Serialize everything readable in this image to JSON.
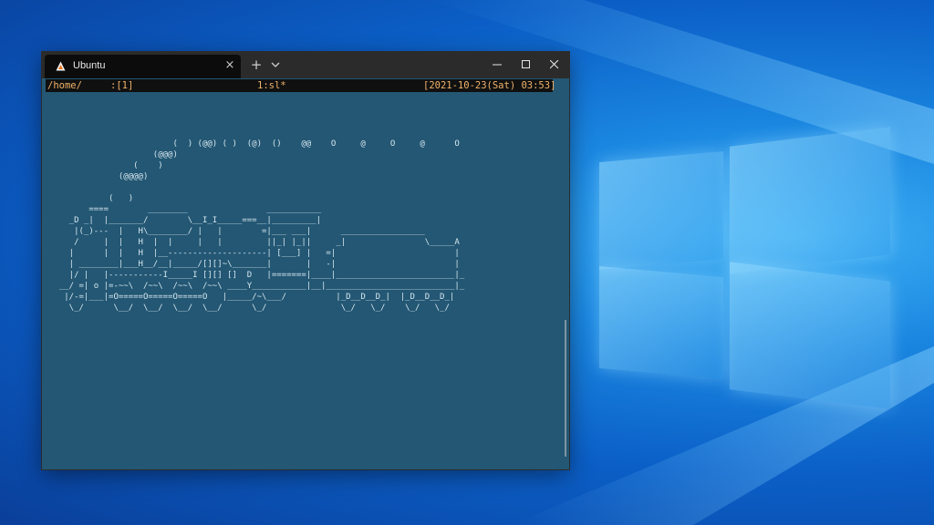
{
  "window": {
    "tab_title": "Ubuntu",
    "new_tab_symbol": "+",
    "close_tab_symbol": "×"
  },
  "statusbar": {
    "left": "/home/",
    "window_index": ":[1]",
    "window_name": "1:sl*",
    "datetime": "[2021-10-23(Sat) 03:53]"
  },
  "terminal": {
    "art_lines": [
      "                         (  ) (@@) ( )  (@)  ()    @@    O     @     O     @      O",
      "                     (@@@)",
      "                 (    )",
      "              (@@@@)",
      "",
      "            (   )",
      "        ====        ________                ___________",
      "    _D _|  |_______/        \\__I_I_____===__|_________|",
      "     |(_)---  |   H\\________/ |   |        =|___ ___|      _________________",
      "     /     |  |   H  |  |     |   |         ||_| |_||     _|                \\_____A",
      "    |      |  |   H  |__--------------------| [___] |   =|                        |",
      "    | ________|___H__/__|_____/[][]~\\_______|       |   -|                        |",
      "    |/ |   |-----------I_____I [][] []  D   |=======|____|________________________|_",
      "  __/ =| o |=-~~\\  /~~\\  /~~\\  /~~\\ ____Y___________|__|__________________________|_",
      "   |/-=|___|=O=====O=====O=====O   |_____/~\\___/          |_D__D__D_|  |_D__D__D_|",
      "    \\_/      \\__/  \\__/  \\__/  \\__/      \\_/               \\_/   \\_/    \\_/   \\_/"
    ]
  },
  "colors": {
    "terminal_bg": "#235774",
    "statusbar_bg": "#101010",
    "statusbar_fg": "#f2b36a",
    "titlebar_bg": "#2b2b2b",
    "tab_bg": "#0c0c0c"
  },
  "icons": [
    "ubuntu-icon",
    "close-icon",
    "new-tab-icon",
    "chevron-down-icon",
    "minimize-icon",
    "maximize-icon",
    "window-close-icon",
    "windows-logo"
  ]
}
